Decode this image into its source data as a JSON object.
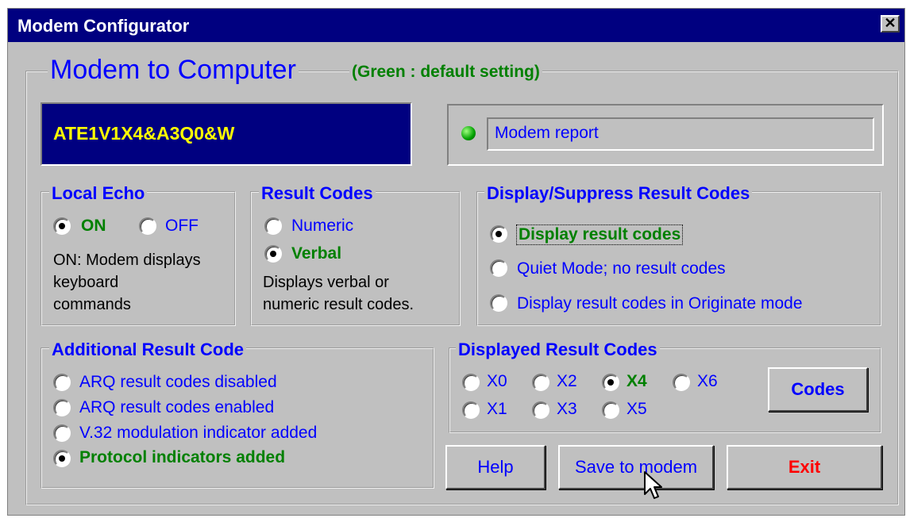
{
  "window": {
    "title": "Modem Configurator",
    "close_glyph": "✕"
  },
  "header": {
    "title": "Modem to Computer",
    "note": "(Green : default setting)"
  },
  "command_display": {
    "value": "ATE1V1X4&A3Q0&W"
  },
  "modem_report": {
    "indicator_icon": "green-led-icon",
    "label": "Modem report"
  },
  "local_echo": {
    "legend": "Local Echo",
    "on_label": "ON",
    "off_label": "OFF",
    "selected": "ON",
    "desc": [
      "ON: Modem displays",
      "keyboard",
      "commands"
    ]
  },
  "result_codes": {
    "legend": "Result Codes",
    "numeric_label": "Numeric",
    "verbal_label": "Verbal",
    "selected": "Verbal",
    "desc": [
      "Displays verbal or",
      "numeric result codes."
    ]
  },
  "display_suppress": {
    "legend": "Display/Suppress Result Codes",
    "options": [
      "Display result codes",
      "Quiet Mode; no result codes",
      "Display result codes in Originate mode"
    ],
    "selected": "Display result codes"
  },
  "additional": {
    "legend": "Additional Result Code",
    "options": [
      "ARQ result codes disabled",
      "ARQ result codes enabled",
      "V.32 modulation indicator added",
      "Protocol indicators added"
    ],
    "selected": "Protocol indicators added"
  },
  "displayed": {
    "legend": "Displayed Result Codes",
    "options": [
      "X0",
      "X2",
      "X4",
      "X6",
      "X1",
      "X3",
      "X5"
    ],
    "selected": "X4",
    "codes_button": "Codes"
  },
  "buttons": {
    "help": "Help",
    "save": "Save to modem",
    "exit": "Exit"
  },
  "colors": {
    "title_bar": "#000080",
    "accent": "#0000ff",
    "default_green": "#008000",
    "exit_red": "#ff0000",
    "command_text": "#ffff00",
    "face": "#c0c0c0"
  }
}
